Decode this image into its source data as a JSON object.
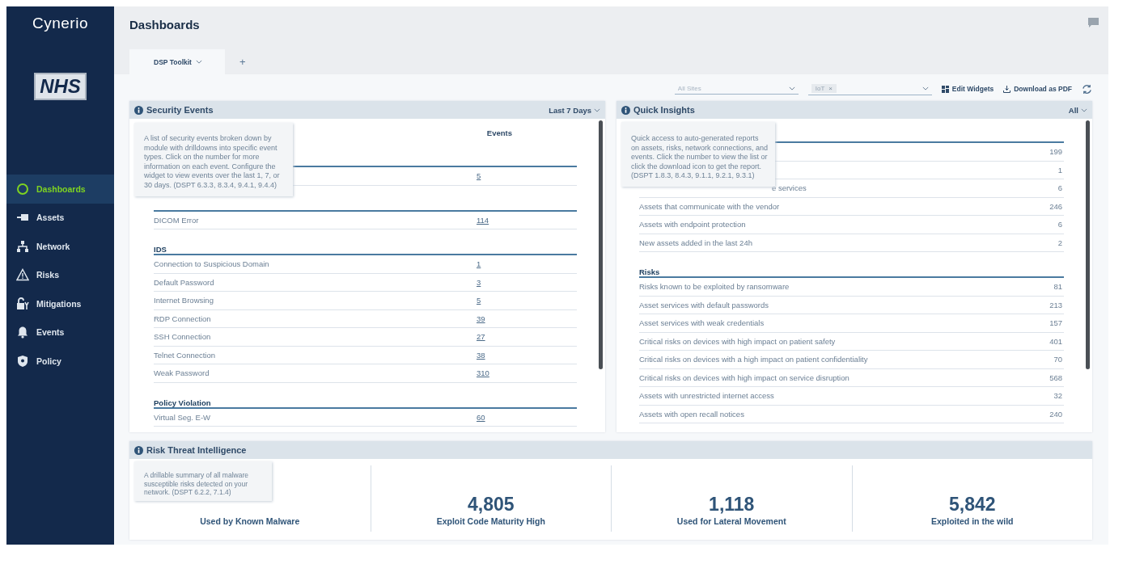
{
  "brand": {
    "logo": "Cynerio",
    "org": "NHS"
  },
  "sidebar": {
    "items": [
      {
        "label": "Dashboards",
        "selected": true
      },
      {
        "label": "Assets",
        "selected": false
      },
      {
        "label": "Network",
        "selected": false
      },
      {
        "label": "Risks",
        "selected": false
      },
      {
        "label": "Mitigations",
        "selected": false
      },
      {
        "label": "Events",
        "selected": false
      },
      {
        "label": "Policy",
        "selected": false
      }
    ]
  },
  "header": {
    "title": "Dashboards"
  },
  "tabs": [
    {
      "label": "DSP Toolkit",
      "selected": true
    },
    {
      "label": "+",
      "selected": false
    }
  ],
  "filters": {
    "site": {
      "placeholder": "All Sites"
    },
    "type": {
      "chip": "IoT",
      "remove": "×"
    },
    "edit": "Edit Widgets",
    "download": "Download as PDF"
  },
  "security_events": {
    "title": "Security Events",
    "range": "Last 7 Days",
    "column": "Events",
    "tooltip": "A list of security events broken down by module with drilldowns into specific event types. Click on the number for more information on each event. Configure the widget to view events over the last 1, 7, or 30 days. (DSPT 6.3.3, 8.3.4, 9.4.1, 9.4.4)",
    "sections": [
      {
        "rows": [
          {
            "value": "5"
          }
        ]
      },
      {
        "rows": [
          {
            "label": "DICOM Error",
            "value": "114"
          }
        ]
      },
      {
        "heading": "IDS",
        "rows": [
          {
            "label": "Connection to Suspicious Domain",
            "value": "1"
          },
          {
            "label": "Default Password",
            "value": "3"
          },
          {
            "label": "Internet Browsing",
            "value": "5"
          },
          {
            "label": "RDP Connection",
            "value": "39"
          },
          {
            "label": "SSH Connection",
            "value": "27"
          },
          {
            "label": "Telnet Connection",
            "value": "38"
          },
          {
            "label": "Weak Password",
            "value": "310"
          }
        ]
      },
      {
        "heading": "Policy Violation",
        "rows": [
          {
            "label": "Virtual Seg. E-W",
            "value": "60"
          }
        ]
      }
    ]
  },
  "quick_insights": {
    "title": "Quick Insights",
    "range": "All",
    "tooltip": "Quick access to auto-generated reports on assets, risks, network connections, and events. Click the number to view the list or click the download icon to get the report. (DSPT 1.8.3, 8.4.3, 9.1.1, 9.2.1, 9.3.1)",
    "sections": [
      {
        "rows": [
          {
            "value": "199"
          },
          {
            "value": "1"
          },
          {
            "label": "e services",
            "value": "6",
            "covered": true
          },
          {
            "label": "Assets that communicate with the vendor",
            "value": "246",
            "covered": false
          },
          {
            "label": "Assets with endpoint protection",
            "value": "6",
            "covered": false
          },
          {
            "label": "New assets added in the last 24h",
            "value": "2",
            "covered": false
          }
        ]
      },
      {
        "heading": "Risks",
        "rows": [
          {
            "label": "Risks known to be exploited by ransomware",
            "value": "81",
            "covered": false
          },
          {
            "label": "Asset services with default passwords",
            "value": "213",
            "covered": false
          },
          {
            "label": "Asset services with weak credentials",
            "value": "157",
            "covered": false
          },
          {
            "label": "Critical risks on devices with high impact on patient safety",
            "value": "401",
            "covered": false
          },
          {
            "label": "Critical risks on devices with a high impact on patient confidentiality",
            "value": "70",
            "covered": false
          },
          {
            "label": "Critical risks on devices with high impact on service disruption",
            "value": "568",
            "covered": false
          },
          {
            "label": "Assets with unrestricted internet access",
            "value": "32",
            "covered": false
          },
          {
            "label": "Assets with open recall notices",
            "value": "240",
            "covered": false
          }
        ]
      }
    ]
  },
  "risk_threat": {
    "title": "Risk Threat Intelligence",
    "tooltip": "A drillable summary of all malware susceptible risks detected on your network. (DSPT 6.2.2, 7.1.4)",
    "stats": [
      {
        "label": "Used by Known Malware"
      },
      {
        "value": "4,805",
        "label": "Exploit Code Maturity High"
      },
      {
        "value": "1,118",
        "label": "Used for Lateral Movement"
      },
      {
        "value": "5,842",
        "label": "Exploited in the wild"
      }
    ]
  }
}
